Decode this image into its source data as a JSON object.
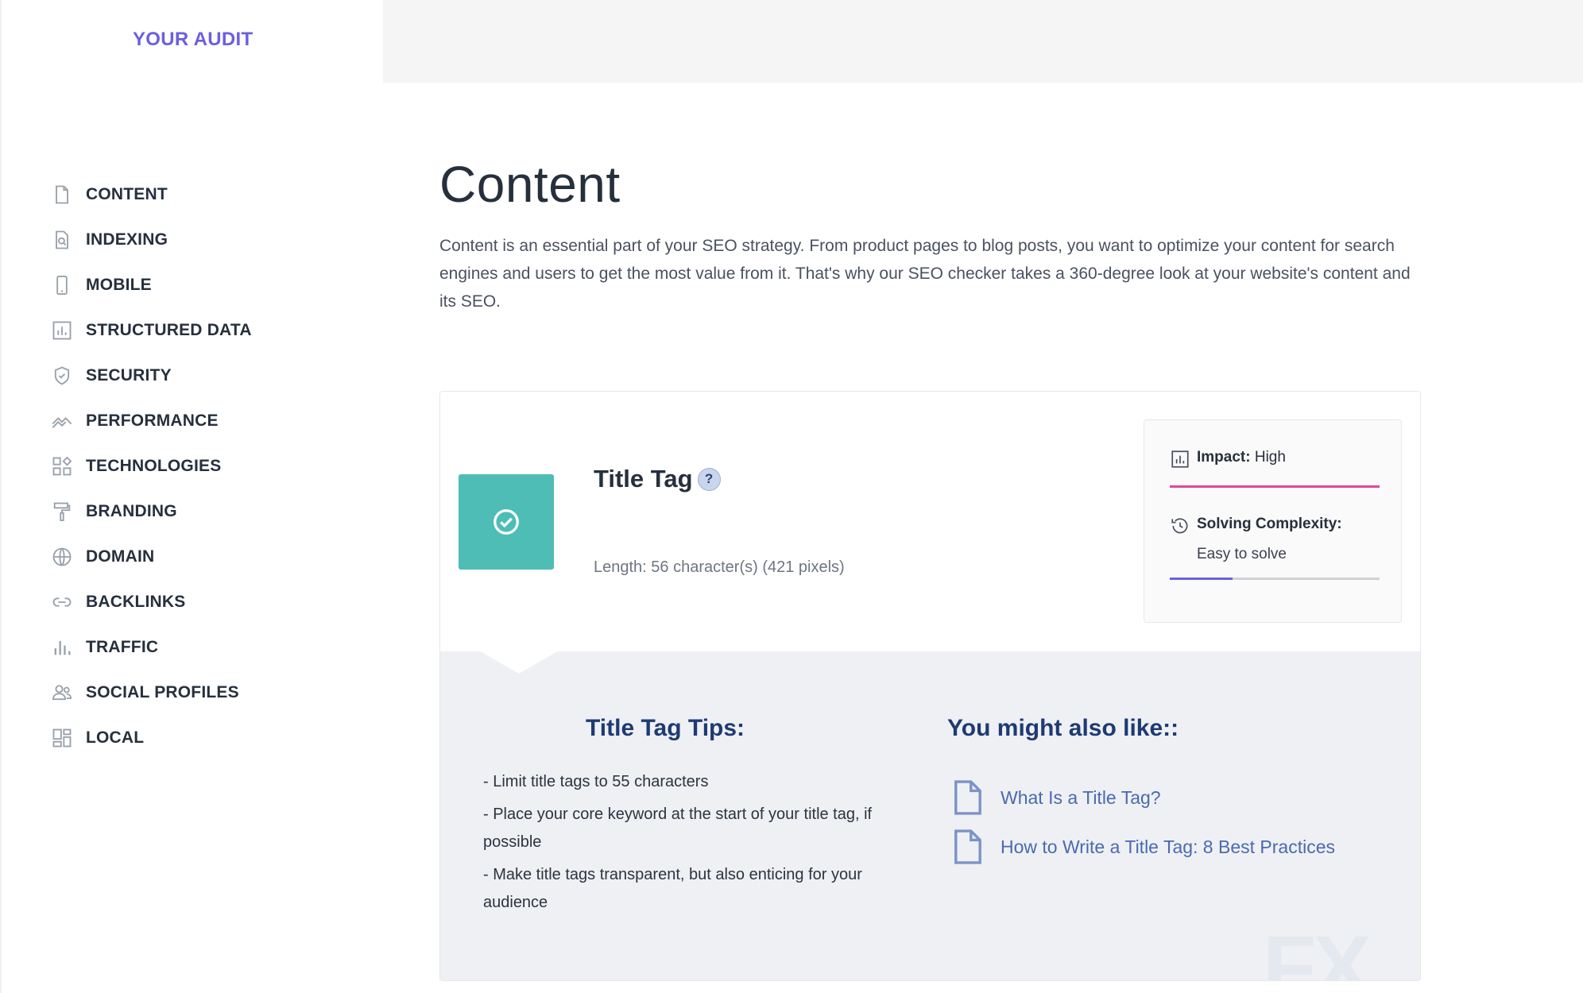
{
  "sidebar": {
    "title": "YOUR AUDIT",
    "items": [
      {
        "label": "CONTENT",
        "icon": "document-icon"
      },
      {
        "label": "INDEXING",
        "icon": "search-document-icon"
      },
      {
        "label": "MOBILE",
        "icon": "mobile-icon"
      },
      {
        "label": "STRUCTURED DATA",
        "icon": "bar-chart-icon"
      },
      {
        "label": "SECURITY",
        "icon": "shield-check-icon"
      },
      {
        "label": "PERFORMANCE",
        "icon": "trend-icon"
      },
      {
        "label": "TECHNOLOGIES",
        "icon": "grid-icon"
      },
      {
        "label": "BRANDING",
        "icon": "paint-roller-icon"
      },
      {
        "label": "DOMAIN",
        "icon": "globe-icon"
      },
      {
        "label": "BACKLINKS",
        "icon": "link-icon"
      },
      {
        "label": "TRAFFIC",
        "icon": "traffic-bars-icon"
      },
      {
        "label": "SOCIAL PROFILES",
        "icon": "users-icon"
      },
      {
        "label": "LOCAL",
        "icon": "dashboard-icon"
      }
    ]
  },
  "main": {
    "title": "Content",
    "description": "Content is an essential part of your SEO strategy. From product pages to blog posts, you want to optimize your content for search engines and users to get the most value from it. That's why our SEO checker takes a 360-degree look at your website's content and its SEO."
  },
  "card": {
    "title": "Title Tag",
    "help": "?",
    "length": "Length: 56 character(s) (421 pixels)",
    "impact_label": "Impact:",
    "impact_value": "High",
    "impact_color": "#e0489a",
    "impact_level": 1.0,
    "complexity_label": "Solving Complexity:",
    "complexity_value": "Easy to solve",
    "complexity_color": "#6b5fe0",
    "complexity_level": 0.3,
    "status_color": "#4dbdb6",
    "tips_heading": "Title Tag Tips:",
    "tips": [
      "- Limit title tags to 55 characters",
      "- Place your core keyword at the start of your title tag, if possible",
      "- Make title tags transparent, but also enticing for your audience"
    ],
    "like_heading": "You might also like::",
    "links": [
      "What Is a Title Tag?",
      "How to Write a Title Tag: 8 Best Practices"
    ],
    "watermark": "FX"
  }
}
